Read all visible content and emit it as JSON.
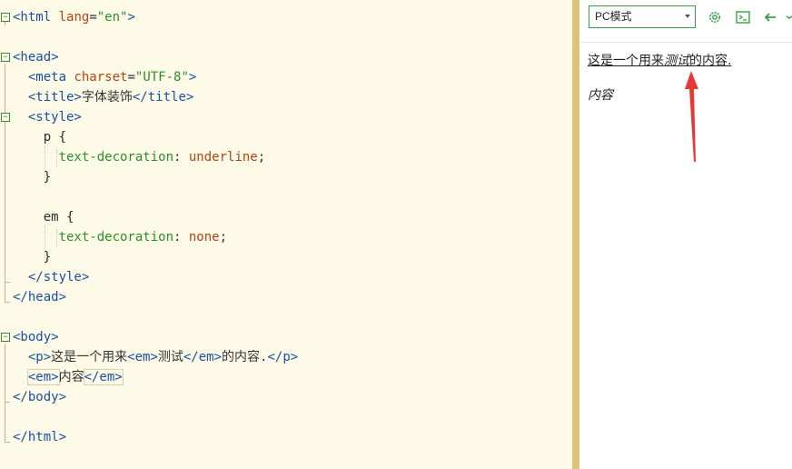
{
  "editor": {
    "lines": [
      {
        "fold": "⊟",
        "parts": [
          [
            "tag",
            "<html"
          ],
          [
            "attr",
            " lang"
          ],
          [
            "pun",
            "="
          ],
          [
            "str",
            "\"en\""
          ],
          [
            "tag",
            ">"
          ]
        ]
      },
      {
        "fold": "",
        "parts": []
      },
      {
        "fold": "⊟",
        "parts": [
          [
            "tag",
            "<head>"
          ]
        ]
      },
      {
        "fold": "",
        "parts": [
          [
            "pun",
            "  "
          ],
          [
            "tag",
            "<meta"
          ],
          [
            "attr",
            " charset"
          ],
          [
            "pun",
            "="
          ],
          [
            "str",
            "\"UTF-8\""
          ],
          [
            "tag",
            ">"
          ]
        ]
      },
      {
        "fold": "",
        "parts": [
          [
            "pun",
            "  "
          ],
          [
            "tag",
            "<title>"
          ],
          [
            "txt",
            "字体装饰"
          ],
          [
            "tag",
            "</title>"
          ]
        ]
      },
      {
        "fold": "⊟",
        "parts": [
          [
            "pun",
            "  "
          ],
          [
            "tag",
            "<style>"
          ]
        ]
      },
      {
        "fold": "",
        "parts": [
          [
            "pun",
            "    "
          ],
          [
            "sel",
            "p {"
          ]
        ]
      },
      {
        "fold": "",
        "parts": [
          [
            "pun",
            "      "
          ],
          [
            "prop",
            "text-decoration"
          ],
          [
            "pun",
            ": "
          ],
          [
            "val",
            "underline"
          ],
          [
            "pun",
            ";"
          ]
        ]
      },
      {
        "fold": "",
        "parts": [
          [
            "pun",
            "    "
          ],
          [
            "sel",
            "}"
          ]
        ]
      },
      {
        "fold": "",
        "parts": []
      },
      {
        "fold": "",
        "parts": [
          [
            "pun",
            "    "
          ],
          [
            "sel",
            "em {"
          ]
        ]
      },
      {
        "fold": "",
        "parts": [
          [
            "pun",
            "      "
          ],
          [
            "prop",
            "text-decoration"
          ],
          [
            "pun",
            ": "
          ],
          [
            "val",
            "none"
          ],
          [
            "pun",
            ";"
          ]
        ]
      },
      {
        "fold": "",
        "parts": [
          [
            "pun",
            "    "
          ],
          [
            "sel",
            "}"
          ]
        ]
      },
      {
        "fold": "",
        "parts": [
          [
            "pun",
            "  "
          ],
          [
            "tag",
            "</style>"
          ]
        ]
      },
      {
        "fold": "",
        "parts": [
          [
            "tag",
            "</head>"
          ]
        ]
      },
      {
        "fold": "",
        "parts": []
      },
      {
        "fold": "⊟",
        "parts": [
          [
            "tag",
            "<body>"
          ]
        ]
      },
      {
        "fold": "",
        "parts": [
          [
            "pun",
            "  "
          ],
          [
            "tag",
            "<p>"
          ],
          [
            "txt",
            "这是一个用来"
          ],
          [
            "tag",
            "<em>"
          ],
          [
            "txt",
            "测试"
          ],
          [
            "tag",
            "</em>"
          ],
          [
            "txt",
            "的内容."
          ],
          [
            "tag",
            "</p>"
          ]
        ]
      },
      {
        "fold": "",
        "parts": [
          [
            "pun",
            "  "
          ],
          [
            "tag",
            "<em>"
          ],
          [
            "txt",
            "内容"
          ],
          [
            "tag",
            "</em>"
          ]
        ]
      },
      {
        "fold": "",
        "parts": [
          [
            "tag",
            "</body>"
          ]
        ]
      },
      {
        "fold": "",
        "parts": []
      },
      {
        "fold": "",
        "parts": [
          [
            "tag",
            "</html>"
          ]
        ]
      }
    ]
  },
  "preview": {
    "mode_label": "PC模式",
    "toolbar_icons": [
      "settings-gear-icon",
      "terminal-icon",
      "back-arrow-icon"
    ],
    "accent_color": "#3aa04a",
    "p_before": "这是一个用来",
    "p_em": "测试",
    "p_after": "的内容.",
    "em_text": "内容",
    "arrow_color": "#e53935"
  }
}
